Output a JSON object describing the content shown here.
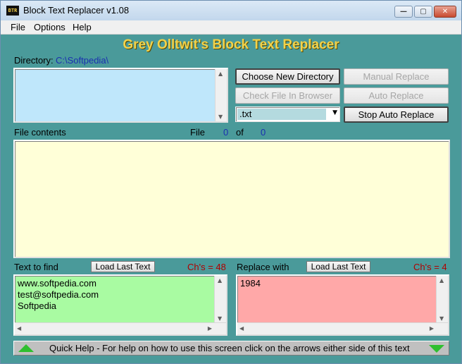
{
  "window": {
    "title": "Block Text Replacer v1.08",
    "app_icon_text": "BTR"
  },
  "controls": {
    "minimize": "—",
    "maximize": "▢",
    "close": "✕"
  },
  "menu": [
    "File",
    "Options",
    "Help"
  ],
  "heading": "Grey Olltwit's Block Text Replacer",
  "directory": {
    "label": "Directory:",
    "path": "C:\\Softpedia\\"
  },
  "buttons": {
    "choose_dir": "Choose New Directory",
    "check_file": "Check File In Browser",
    "manual_replace": "Manual Replace",
    "auto_replace": "Auto Replace",
    "stop_auto_replace": "Stop Auto Replace",
    "load_last_text_find": "Load Last Text",
    "load_last_text_replace": "Load Last Text"
  },
  "extension_select": {
    "value": ".txt"
  },
  "file_contents": {
    "label": "File contents",
    "file_label": "File",
    "file_index": "0",
    "of_label": "of",
    "file_total": "0"
  },
  "find": {
    "label": "Text to find",
    "count_label": "Ch's = 48",
    "lines": [
      "www.softpedia.com",
      "test@softpedia.com",
      "Softpedia"
    ]
  },
  "replace": {
    "label": "Replace with",
    "count_label": "Ch's = 4",
    "text": "1984"
  },
  "quick_help": "Quick Help - For help on how to use this screen click on the arrows either side of this text",
  "colors": {
    "teal_bg": "#4a9a9a",
    "heading": "#f2d24a",
    "dir_list": "#bfe7fb",
    "contents": "#ffffd8",
    "find": "#a9fba2",
    "replace": "#ffa8a8",
    "arrow_green": "#2fbf2f"
  }
}
